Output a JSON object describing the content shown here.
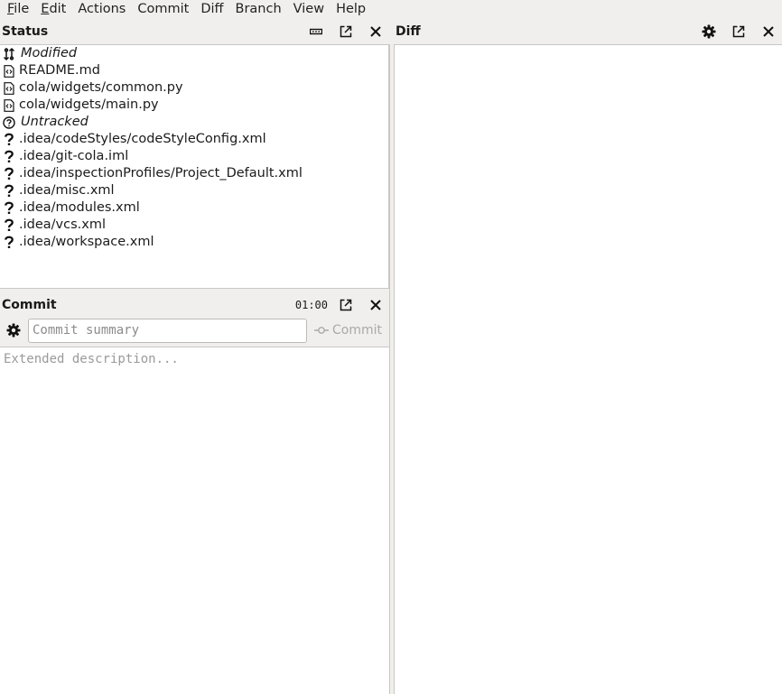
{
  "menu": [
    {
      "mnemonic": "F",
      "rest": "ile"
    },
    {
      "mnemonic": "E",
      "rest": "dit"
    },
    {
      "mnemonic": "",
      "rest": "Actions"
    },
    {
      "mnemonic": "",
      "rest": "Commit"
    },
    {
      "mnemonic": "",
      "rest": "Diff"
    },
    {
      "mnemonic": "",
      "rest": "Branch"
    },
    {
      "mnemonic": "",
      "rest": "View"
    },
    {
      "mnemonic": "",
      "rest": "Help"
    }
  ],
  "status": {
    "title": "Status",
    "modified_header": "Modified",
    "modified": [
      "README.md",
      "cola/widgets/common.py",
      "cola/widgets/main.py"
    ],
    "untracked_header": "Untracked",
    "untracked": [
      ".idea/codeStyles/codeStyleConfig.xml",
      ".idea/git-cola.iml",
      ".idea/inspectionProfiles/Project_Default.xml",
      ".idea/misc.xml",
      ".idea/modules.xml",
      ".idea/vcs.xml",
      ".idea/workspace.xml"
    ]
  },
  "commit": {
    "title": "Commit",
    "timer": "01:00",
    "summary_value": "",
    "summary_placeholder": "Commit summary",
    "commit_label": "Commit",
    "description_placeholder": "Extended description..."
  },
  "diff": {
    "title": "Diff"
  },
  "icons": {
    "modified_group": "sync-icon",
    "modified_file": "code-file-icon",
    "untracked_group": "question-circle-icon",
    "untracked_file": "question-icon"
  }
}
